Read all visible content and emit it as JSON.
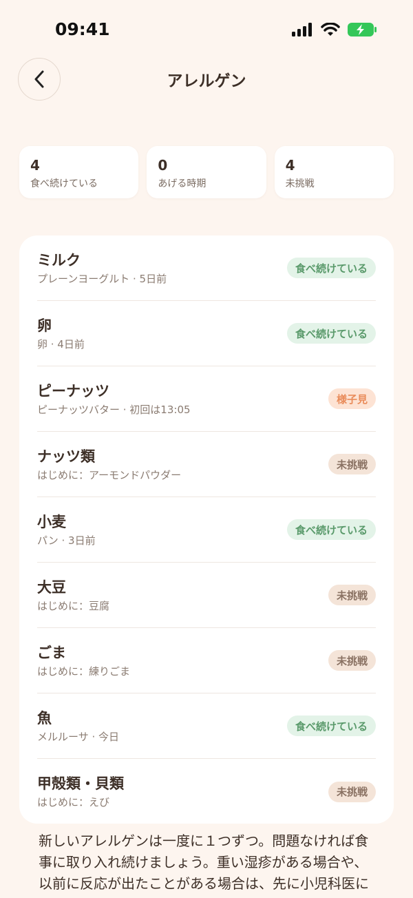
{
  "status_bar": {
    "time": "09:41"
  },
  "header": {
    "title": "アレルゲン"
  },
  "stats": [
    {
      "value": "4",
      "label": "食べ続けている"
    },
    {
      "value": "0",
      "label": "あげる時期"
    },
    {
      "value": "4",
      "label": "未挑戦"
    }
  ],
  "allergens": [
    {
      "name": "ミルク",
      "detail": "プレーンヨーグルト · 5日前",
      "status": "食べ続けている"
    },
    {
      "name": "卵",
      "detail": "卵 · 4日前",
      "status": "食べ続けている"
    },
    {
      "name": "ピーナッツ",
      "detail": "ピーナッツバター · 初回は13:05",
      "status": "様子見"
    },
    {
      "name": "ナッツ類",
      "detail": "はじめに：アーモンドパウダー",
      "status": "未挑戦"
    },
    {
      "name": "小麦",
      "detail": "パン · 3日前",
      "status": "食べ続けている"
    },
    {
      "name": "大豆",
      "detail": "はじめに：豆腐",
      "status": "未挑戦"
    },
    {
      "name": "ごま",
      "detail": "はじめに：練りごま",
      "status": "未挑戦"
    },
    {
      "name": "魚",
      "detail": "メルルーサ · 今日",
      "status": "食べ続けている"
    },
    {
      "name": "甲殻類・貝類",
      "detail": "はじめに：えび",
      "status": "未挑戦"
    }
  ],
  "footer": {
    "note": "新しいアレルゲンは一度に１つずつ。問題なければ食事に取り入れ続けましょう。重い湿疹がある場合や、以前に反応が出たことがある場合は、先に小児科医に相談してください。"
  },
  "colors": {
    "background": "#fdf5ef",
    "badge_green": "#5a9a6b",
    "badge_orange": "#e98c5b",
    "badge_tan": "#8a7263"
  }
}
